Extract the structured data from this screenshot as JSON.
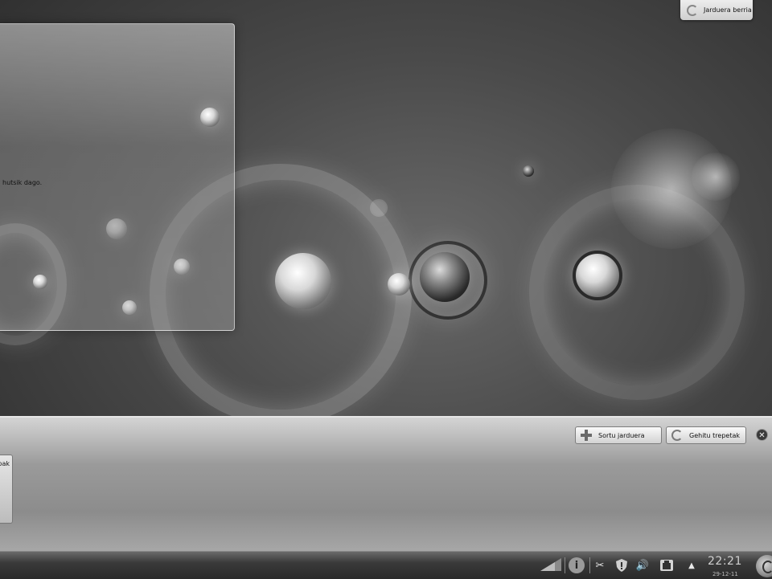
{
  "wallpaper": {},
  "folder_view": {
    "empty_message": "hutsik dago."
  },
  "activity_manager": {
    "new_activity_label": "Jarduera berria"
  },
  "activity_bar": {
    "create_activity_label": "Sortu jarduera",
    "add_widgets_label": "Gehitu trepetak",
    "thumbnail_label": "pak"
  },
  "panel": {
    "clock": {
      "time": "22:21",
      "date": "29-12-11"
    },
    "tray_icons": [
      "network-icon",
      "info-icon",
      "klipper-scissors-icon",
      "security-shield-icon",
      "volume-icon",
      "device-notifier-icon",
      "tray-expand-arrow-icon"
    ]
  }
}
